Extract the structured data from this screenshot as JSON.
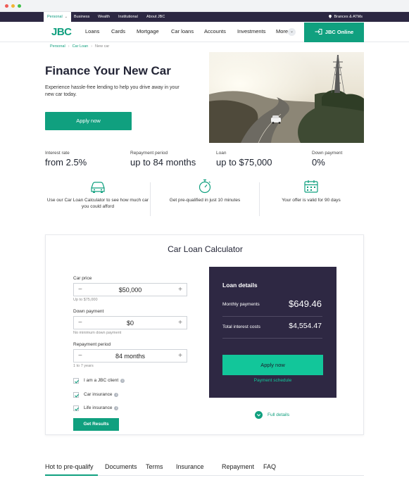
{
  "topbar": {
    "segments": [
      "Personal",
      "Business",
      "Wealth",
      "Institutional",
      "About JBC"
    ],
    "branches": "Brances & ATMs"
  },
  "nav": {
    "logo": "JBC",
    "links": [
      "Loans",
      "Cards",
      "Mortgage",
      "Car loans",
      "Accounts",
      "Investments",
      "More"
    ],
    "online_button": "JBC Online"
  },
  "breadcrumb": [
    "Personal",
    "Car Loan",
    "New car"
  ],
  "hero": {
    "title": "Finance Your New Car",
    "subtitle": "Experience hassle-free lending to help you drive away in your new car today.",
    "apply_button": "Apply now"
  },
  "stats": [
    {
      "label": "Interest rate",
      "value": "from 2.5%"
    },
    {
      "label": "Repayment period",
      "value": "up to 84 months"
    },
    {
      "label": "Loan",
      "value": "up to $75,000"
    },
    {
      "label": "Down payment",
      "value": "0%"
    }
  ],
  "features": [
    {
      "icon": "car-icon",
      "text": "Use our Car Loan Calculator to see how much car you could afford"
    },
    {
      "icon": "stopwatch-icon",
      "text": "Get pre-qualified in just 10 minutes"
    },
    {
      "icon": "calendar-icon",
      "text": "Your offer is valid for 90 days"
    }
  ],
  "calculator": {
    "title": "Car Loan Calculator",
    "car_price": {
      "label": "Car price",
      "value": "$50,000",
      "hint": "Up to $75,000"
    },
    "down_payment": {
      "label": "Down payment",
      "value": "$0",
      "hint": "No minimum down payment"
    },
    "repayment_period": {
      "label": "Repayment period",
      "value": "84 months",
      "hint": "1 to 7 years"
    },
    "checkboxes": [
      {
        "label": "I am a JBC client",
        "checked": true
      },
      {
        "label": "Car insurance",
        "checked": true
      },
      {
        "label": "Life insurance",
        "checked": true
      }
    ],
    "results_button": "Get Results"
  },
  "loan_details": {
    "title": "Loan details",
    "monthly_label": "Monthly payments",
    "monthly_value": "$649.46",
    "interest_label": "Total interest costs",
    "interest_value": "$4,554.47",
    "apply_button": "Apply now",
    "schedule_link": "Payment schedule"
  },
  "full_details": "Full details",
  "tabs": [
    "Hot to pre-qualify",
    "Documents",
    "Terms",
    "Insurance",
    "Repayment",
    "FAQ"
  ],
  "colors": {
    "accent": "#10a07f",
    "dark": "#2e2843",
    "bright_accent": "#12c69a"
  }
}
